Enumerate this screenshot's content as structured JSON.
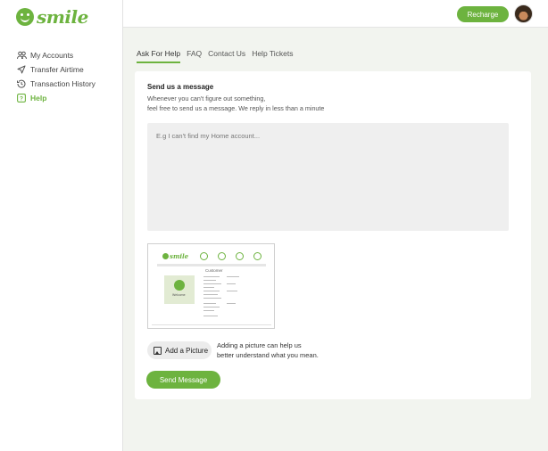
{
  "brand": {
    "name": "smile",
    "accent": "#6db33f"
  },
  "sidebar": {
    "items": [
      {
        "label": "My Accounts",
        "icon": "users-icon",
        "active": false
      },
      {
        "label": "Transfer Airtime",
        "icon": "send-icon",
        "active": false
      },
      {
        "label": "Transaction History",
        "icon": "history-icon",
        "active": false
      },
      {
        "label": "Help",
        "icon": "help-icon",
        "active": true
      }
    ]
  },
  "header": {
    "recharge_label": "Recharge",
    "avatar": "user-avatar"
  },
  "tabs": [
    {
      "label": "Ask For Help",
      "active": true
    },
    {
      "label": "FAQ",
      "active": false
    },
    {
      "label": "Contact Us",
      "active": false
    },
    {
      "label": "Help Tickets",
      "active": false
    }
  ],
  "form": {
    "title": "Send us a message",
    "subtitle_line1": "Whenever you can't figure out something,",
    "subtitle_line2": "feel free to send us a message. We reply in less than a minute",
    "message_placeholder": "E.g I can't find my Home account...",
    "message_value": "",
    "attachment": {
      "brand_word": "smile",
      "panel_title": "Customer",
      "panel_name": "Welcome"
    },
    "add_picture_label": "Add a Picture",
    "picture_hint_line1": "Adding a picture can help us",
    "picture_hint_line2": "better understand what you mean.",
    "send_label": "Send Message"
  }
}
